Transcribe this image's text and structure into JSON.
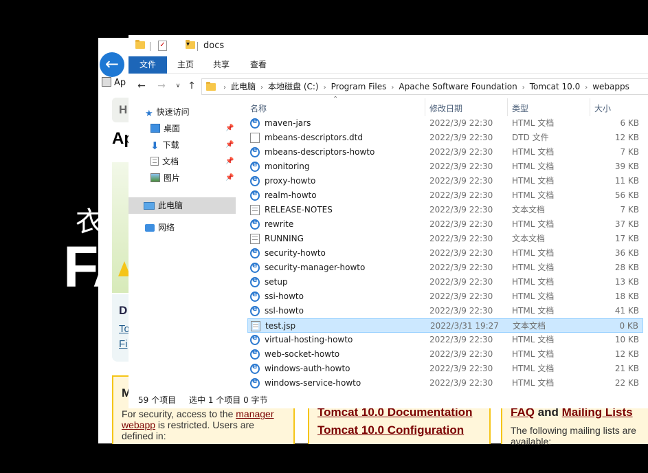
{
  "background_browser": {
    "tab_text": "Ap",
    "nav_text": "H",
    "heading": "Ap",
    "section_heading": "D",
    "link1": "To",
    "link2": "Fi",
    "big_text_top": "衣",
    "big_text_bottom": "FA",
    "cards": [
      {
        "title": "M",
        "text_before": "For security, access to the ",
        "link": "manager webapp",
        "text_after": " is restricted. Users are defined in:"
      },
      {
        "links": [
          "Tomcat 10.0 Documentation",
          "Tomcat 10.0 Configuration"
        ]
      },
      {
        "title_link1": "FAQ",
        "title_and": " and ",
        "title_link2": "Mailing Lists",
        "text": "The following mailing lists are available:"
      }
    ]
  },
  "explorer": {
    "title": "docs",
    "ribbon_tabs": {
      "file": "文件",
      "home": "主页",
      "share": "共享",
      "view": "查看"
    },
    "breadcrumb": [
      "此电脑",
      "本地磁盘 (C:)",
      "Program Files",
      "Apache Software Foundation",
      "Tomcat 10.0",
      "webapps"
    ],
    "nav": {
      "quick_access": "快速访问",
      "desktop": "桌面",
      "downloads": "下载",
      "documents": "文档",
      "pictures": "图片",
      "this_pc": "此电脑",
      "network": "网络"
    },
    "columns": {
      "name": "名称",
      "date": "修改日期",
      "type": "类型",
      "size": "大小"
    },
    "files": [
      {
        "name": "maven-jars",
        "date": "2022/3/9 22:30",
        "type": "HTML 文档",
        "size": "6 KB",
        "icon": "ie"
      },
      {
        "name": "mbeans-descriptors.dtd",
        "date": "2022/3/9 22:30",
        "type": "DTD 文件",
        "size": "12 KB",
        "icon": "doc"
      },
      {
        "name": "mbeans-descriptors-howto",
        "date": "2022/3/9 22:30",
        "type": "HTML 文档",
        "size": "7 KB",
        "icon": "ie"
      },
      {
        "name": "monitoring",
        "date": "2022/3/9 22:30",
        "type": "HTML 文档",
        "size": "39 KB",
        "icon": "ie"
      },
      {
        "name": "proxy-howto",
        "date": "2022/3/9 22:30",
        "type": "HTML 文档",
        "size": "11 KB",
        "icon": "ie"
      },
      {
        "name": "realm-howto",
        "date": "2022/3/9 22:30",
        "type": "HTML 文档",
        "size": "56 KB",
        "icon": "ie"
      },
      {
        "name": "RELEASE-NOTES",
        "date": "2022/3/9 22:30",
        "type": "文本文档",
        "size": "7 KB",
        "icon": "txt"
      },
      {
        "name": "rewrite",
        "date": "2022/3/9 22:30",
        "type": "HTML 文档",
        "size": "37 KB",
        "icon": "ie"
      },
      {
        "name": "RUNNING",
        "date": "2022/3/9 22:30",
        "type": "文本文档",
        "size": "17 KB",
        "icon": "txt"
      },
      {
        "name": "security-howto",
        "date": "2022/3/9 22:30",
        "type": "HTML 文档",
        "size": "36 KB",
        "icon": "ie"
      },
      {
        "name": "security-manager-howto",
        "date": "2022/3/9 22:30",
        "type": "HTML 文档",
        "size": "28 KB",
        "icon": "ie"
      },
      {
        "name": "setup",
        "date": "2022/3/9 22:30",
        "type": "HTML 文档",
        "size": "13 KB",
        "icon": "ie"
      },
      {
        "name": "ssi-howto",
        "date": "2022/3/9 22:30",
        "type": "HTML 文档",
        "size": "18 KB",
        "icon": "ie"
      },
      {
        "name": "ssl-howto",
        "date": "2022/3/9 22:30",
        "type": "HTML 文档",
        "size": "41 KB",
        "icon": "ie"
      },
      {
        "name": "test.jsp",
        "date": "2022/3/31 19:27",
        "type": "文本文档",
        "size": "0 KB",
        "icon": "txt",
        "selected": true
      },
      {
        "name": "virtual-hosting-howto",
        "date": "2022/3/9 22:30",
        "type": "HTML 文档",
        "size": "10 KB",
        "icon": "ie"
      },
      {
        "name": "web-socket-howto",
        "date": "2022/3/9 22:30",
        "type": "HTML 文档",
        "size": "12 KB",
        "icon": "ie"
      },
      {
        "name": "windows-auth-howto",
        "date": "2022/3/9 22:30",
        "type": "HTML 文档",
        "size": "21 KB",
        "icon": "ie"
      },
      {
        "name": "windows-service-howto",
        "date": "2022/3/9 22:30",
        "type": "HTML 文档",
        "size": "22 KB",
        "icon": "ie"
      }
    ],
    "status": {
      "count": "59 个项目",
      "selection": "选中 1 个项目  0 字节"
    }
  },
  "colors": {
    "accent": "#1d66b8",
    "selection": "#cce8ff",
    "card_border": "#f5c518"
  }
}
